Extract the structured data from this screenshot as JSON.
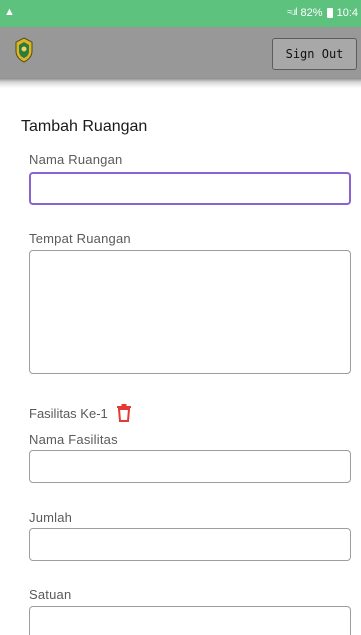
{
  "status_bar": {
    "warning_icon": "warning-triangle-icon",
    "battery_percent": "82%",
    "time": "10:4"
  },
  "app_bar": {
    "logo_icon": "shield-emblem-icon",
    "sign_out_label": "Sign Out"
  },
  "form": {
    "title": "Tambah Ruangan",
    "room_name_label": "Nama Ruangan",
    "room_name_value": "",
    "room_place_label": "Tempat Ruangan",
    "room_place_value": "",
    "facility_heading": "Fasilitas Ke-1",
    "delete_icon": "trash-icon",
    "facility_name_label": "Nama Fasilitas",
    "facility_name_value": "",
    "quantity_label": "Jumlah",
    "quantity_value": "",
    "unit_label": "Satuan",
    "unit_value": ""
  },
  "colors": {
    "status_bar": "#5ec27f",
    "app_bar": "#989898",
    "focus_border": "#8a63d2",
    "delete_icon": "#e53935"
  }
}
